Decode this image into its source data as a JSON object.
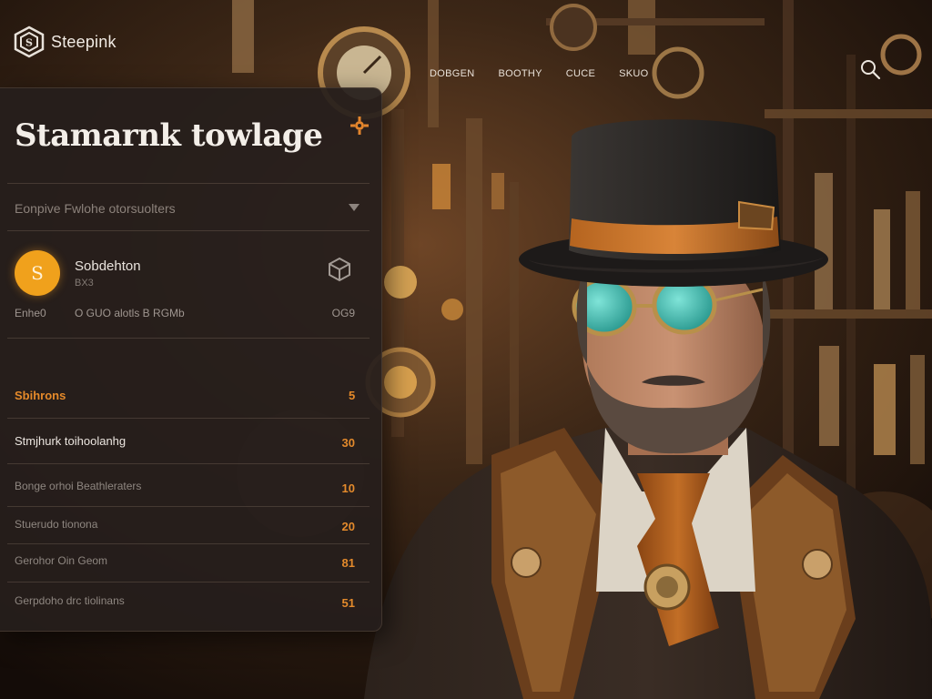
{
  "brand": {
    "name": "Steepink"
  },
  "topnav": [
    "DOBGEN",
    "BOOTHY",
    "CUCE",
    "SKUO"
  ],
  "panel": {
    "title": "Stamarnk towlage",
    "filter_text": "Eonpive Fwlohe otorsuolters",
    "user": {
      "avatar_glyph": "S",
      "name": "Sobdehton",
      "sub": "BX3",
      "stats": [
        "Enhe0",
        "O GUO alotls B RGMb",
        "OG9"
      ]
    },
    "section": {
      "title": "Sbihrons",
      "count": "5"
    },
    "items": [
      {
        "label": "Stmjhurk toihoolanhg",
        "count": "30"
      },
      {
        "label": "Bonge orhoi Beathleraters",
        "count": "10"
      },
      {
        "label": "Stuerudo tionona",
        "count": "20"
      },
      {
        "label": "Gerohor Oin Geom",
        "count": "81"
      },
      {
        "label": "Gerpdoho drc tiolinans",
        "count": "51"
      }
    ]
  },
  "colors": {
    "accent": "#e58a2a",
    "avatar": "#f0a11c",
    "panel": "#261e1c"
  },
  "icons": {
    "logo": "steampunk-cube-logo-icon",
    "search": "search-icon",
    "gear": "gear-icon",
    "dropdown": "chevron-down-icon",
    "box": "cube-icon"
  }
}
